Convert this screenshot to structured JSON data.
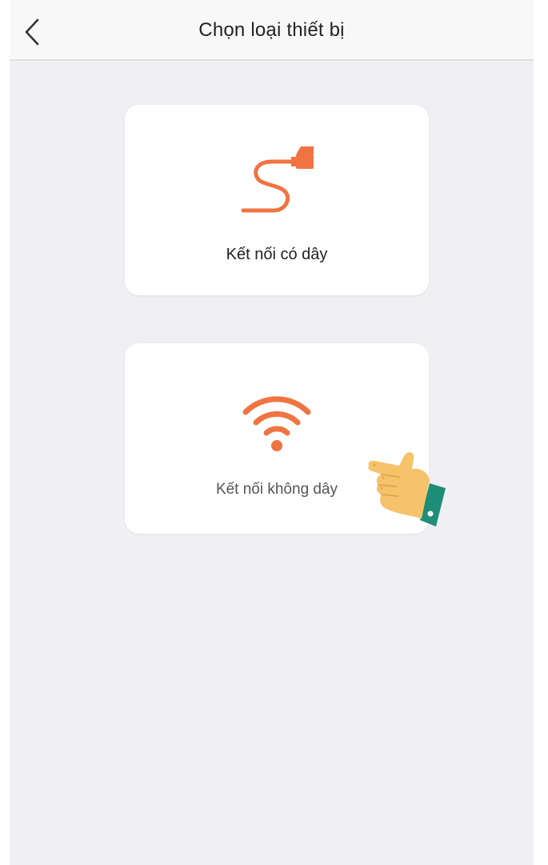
{
  "header": {
    "title": "Chọn loại thiết bị",
    "back_icon": "chevron-left-icon"
  },
  "options": [
    {
      "label": "Kết nối có dây",
      "icon": "ethernet-cable-icon"
    },
    {
      "label": "Kết nối không dây",
      "icon": "wifi-icon"
    }
  ],
  "overlay": {
    "icon": "hand-pointer-icon"
  },
  "colors": {
    "accent": "#F07442",
    "background": "#F0F0F4",
    "card": "#FFFFFF",
    "header": "#F8F8F8",
    "hand_skin": "#F6C36B",
    "hand_cuff": "#1E8E78"
  }
}
